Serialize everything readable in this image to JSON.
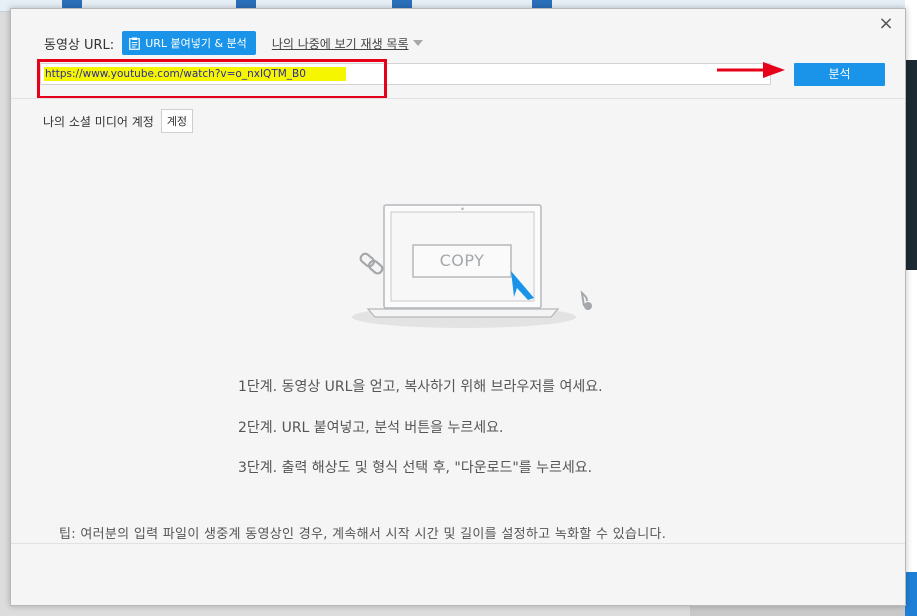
{
  "dialog": {
    "url_label": "동영상 URL:",
    "paste_button": "URL 붙여넣기 & 분석",
    "watch_later": "나의 나중에 보기 재생 목록",
    "url_value": "https://www.youtube.com/watch?v=o_nxIQTM_B0",
    "analyze_button": "분석",
    "account_label": "나의 소셜 미디어 계정",
    "account_button": "계정",
    "close": "×"
  },
  "illustration": {
    "copy_text": "COPY"
  },
  "steps": [
    "1단계. 동영상 URL을 얻고, 복사하기 위해 브라우저를 여세요.",
    "2단계. URL 붙여넣고, 분석 버튼을 누르세요.",
    "3단계. 출력 해상도 및 형식 선택 후, \"다운로드\"를 누르세요."
  ],
  "tip": "팁: 여러분의 입력 파일이 생중계 동영상인 경우, 계속해서 시작 시간 및 길이를 설정하고 녹화할 수 있습니다.",
  "colors": {
    "accent": "#1a94e8",
    "highlight": "#f6f600",
    "annotation_red": "#e6001a"
  }
}
